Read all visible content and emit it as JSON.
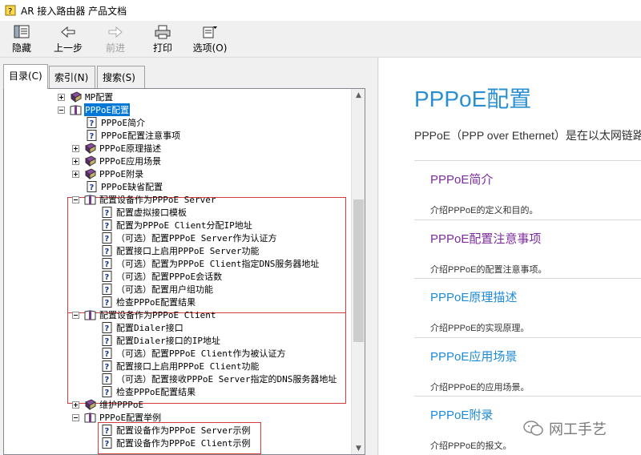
{
  "window": {
    "title": "AR 接入路由器 产品文档"
  },
  "toolbar": {
    "hide": "隐藏",
    "back": "上一步",
    "forward": "前进",
    "print": "打印",
    "options": "选项(O)"
  },
  "tabs": [
    "目录(C)",
    "索引(N)",
    "搜索(S)"
  ],
  "tree": [
    {
      "label": "MP配置",
      "type": "book",
      "exp": "plus"
    },
    {
      "label": "PPPoE配置",
      "type": "book-open",
      "exp": "minus",
      "selected": true
    },
    {
      "label": "PPPoE简介",
      "type": "page"
    },
    {
      "label": "PPPoE配置注意事项",
      "type": "page"
    },
    {
      "label": "PPPoE原理描述",
      "type": "book",
      "exp": "plus"
    },
    {
      "label": "PPPoE应用场景",
      "type": "book",
      "exp": "plus"
    },
    {
      "label": "PPPoE附录",
      "type": "book",
      "exp": "plus"
    },
    {
      "label": "PPPoE缺省配置",
      "type": "page"
    },
    {
      "label": "配置设备作为PPPoE Server",
      "type": "book-open",
      "exp": "minus"
    },
    {
      "label": "配置虚拟接口模板",
      "type": "page"
    },
    {
      "label": "配置为PPPoE Client分配IP地址",
      "type": "page"
    },
    {
      "label": "（可选）配置PPPoE Server作为认证方",
      "type": "page"
    },
    {
      "label": "配置接口上启用PPPoE Server功能",
      "type": "page"
    },
    {
      "label": "（可选）配置为PPPoE Client指定DNS服务器地址",
      "type": "page"
    },
    {
      "label": "（可选）配置PPPoE会话数",
      "type": "page"
    },
    {
      "label": "（可选）配置用户组功能",
      "type": "page"
    },
    {
      "label": "检查PPPoE配置结果",
      "type": "page"
    },
    {
      "label": "配置设备作为PPPoE Client",
      "type": "book-open",
      "exp": "minus"
    },
    {
      "label": "配置Dialer接口",
      "type": "page"
    },
    {
      "label": "配置Dialer接口的IP地址",
      "type": "page"
    },
    {
      "label": "（可选）配置PPPoE Client作为被认证方",
      "type": "page"
    },
    {
      "label": "配置接口上启用PPPoE Client功能",
      "type": "page"
    },
    {
      "label": "（可选）配置接收PPPoE Server指定的DNS服务器地址",
      "type": "page"
    },
    {
      "label": "检查PPPoE配置结果",
      "type": "page"
    },
    {
      "label": "维护PPPoE",
      "type": "book",
      "exp": "plus"
    },
    {
      "label": "PPPoE配置举例",
      "type": "book-open",
      "exp": "minus"
    },
    {
      "label": "配置设备作为PPPoE Server示例",
      "type": "page"
    },
    {
      "label": "配置设备作为PPPoE Client示例",
      "type": "page"
    }
  ],
  "content": {
    "title": "PPPoE配置",
    "intro": "PPPoE（PPP over Ethernet）是在以太网链路",
    "sections": [
      {
        "link": "PPPoE简介",
        "desc": "介绍PPPoE的定义和目的。",
        "visited": true
      },
      {
        "link": "PPPoE配置注意事项",
        "desc": "介绍PPPoE的配置注意事项。",
        "visited": true
      },
      {
        "link": "PPPoE原理描述",
        "desc": "介绍PPPoE的实现原理。",
        "visited": false
      },
      {
        "link": "PPPoE应用场景",
        "desc": "介绍PPPoE的应用场景。",
        "visited": false
      },
      {
        "link": "PPPoE附录",
        "desc": "介绍PPPoE的报文。",
        "visited": false
      }
    ],
    "watermark": "网工手艺"
  },
  "colors": {
    "link": "#1d8ad8",
    "visited": "#7c2b9c",
    "title": "#2a8fd1",
    "highlight_box": "#d23c3c",
    "selection": "#0078d7"
  }
}
